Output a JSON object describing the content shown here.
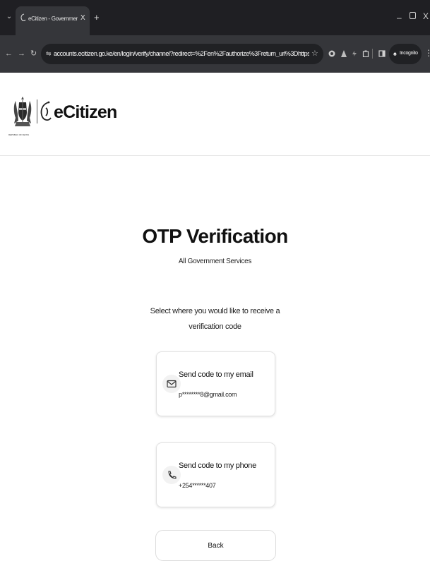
{
  "browser": {
    "tab_title": "eCitizen - Government of Kenya",
    "tab_close": "X",
    "new_tab": "+",
    "url": "accounts.ecitizen.go.ke/en/login/verify/channel?redirect=%2Fen%2Fauthorize%3Freturn_url%3Dhttps%3A%2F%2Fgovernmentpre...",
    "incognito_label": "Incognito"
  },
  "header": {
    "coat_caption": "REPUBLIC OF KENYA",
    "brand": "eCitizen"
  },
  "main": {
    "title": "OTP Verification",
    "subtitle": "All Government Services",
    "instruction_line1": "Select where you would like to receive a",
    "instruction_line2": "verification code",
    "email_option": {
      "label": "Send code to my email",
      "value": "p********8@gmail.com",
      "icon": "mail-icon"
    },
    "phone_option": {
      "label": "Send code to my phone",
      "value": "+254******407",
      "icon": "phone-icon"
    },
    "back_label": "Back"
  }
}
